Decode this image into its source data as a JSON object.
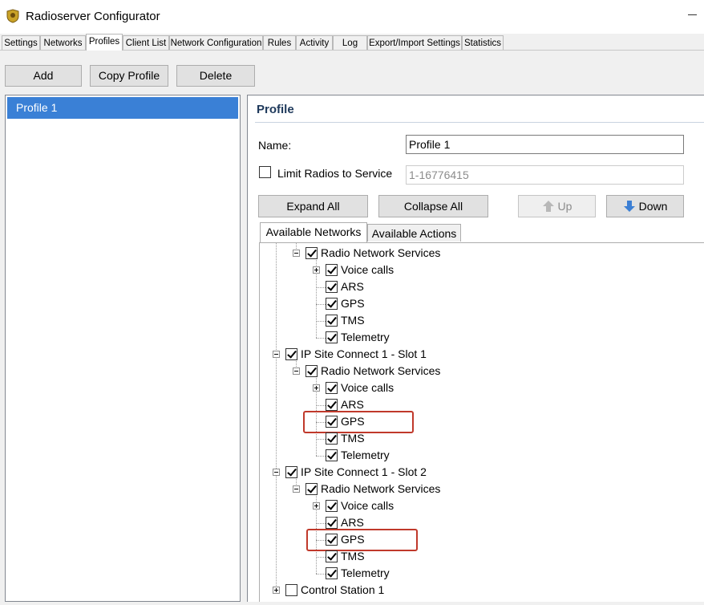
{
  "window": {
    "title": "Radioserver Configurator"
  },
  "tabs": [
    "Settings",
    "Networks",
    "Profiles",
    "Client List",
    "Network Configuration",
    "Rules",
    "Activity",
    "Log",
    "Export/Import Settings",
    "Statistics"
  ],
  "active_tab": "Profiles",
  "toolbar": {
    "add": "Add",
    "copy_profile": "Copy Profile",
    "delete": "Delete"
  },
  "profiles": [
    {
      "label": "Profile 1",
      "selected": true
    }
  ],
  "profile": {
    "heading": "Profile",
    "name_label": "Name:",
    "name_value": "Profile 1",
    "limit_label": "Limit Radios to Service",
    "limit_checked": false,
    "limit_value": "1-16776415",
    "expand_all": "Expand All",
    "collapse_all": "Collapse All",
    "up": "Up",
    "down": "Down",
    "subtabs": [
      "Available Networks",
      "Available Actions"
    ]
  },
  "tree": [
    {
      "label": "Radio Network Services",
      "checked": true,
      "expander": "minus"
    },
    {
      "label": "Voice calls",
      "checked": true,
      "expander": "plus"
    },
    {
      "label": "ARS",
      "checked": true
    },
    {
      "label": "GPS",
      "checked": true
    },
    {
      "label": "TMS",
      "checked": true
    },
    {
      "label": "Telemetry",
      "checked": true
    },
    {
      "label": "IP Site Connect 1 - Slot 1",
      "checked": true,
      "expander": "minus"
    },
    {
      "label": "Radio Network Services",
      "checked": true,
      "expander": "minus"
    },
    {
      "label": "Voice calls",
      "checked": true,
      "expander": "plus"
    },
    {
      "label": "ARS",
      "checked": true
    },
    {
      "label": "GPS",
      "checked": true,
      "highlighted": true
    },
    {
      "label": "TMS",
      "checked": true
    },
    {
      "label": "Telemetry",
      "checked": true
    },
    {
      "label": "IP Site Connect 1 - Slot 2",
      "checked": true,
      "expander": "minus"
    },
    {
      "label": "Radio Network Services",
      "checked": true,
      "expander": "minus"
    },
    {
      "label": "Voice calls",
      "checked": true,
      "expander": "plus"
    },
    {
      "label": "ARS",
      "checked": true
    },
    {
      "label": "GPS",
      "checked": true,
      "highlighted": true
    },
    {
      "label": "TMS",
      "checked": true
    },
    {
      "label": "Telemetry",
      "checked": true
    },
    {
      "label": "Control Station 1",
      "checked": false,
      "expander": "plus"
    }
  ],
  "colors": {
    "selection": "#3a80d6",
    "highlight_box": "#c0392b",
    "section_title": "#1e395b"
  }
}
